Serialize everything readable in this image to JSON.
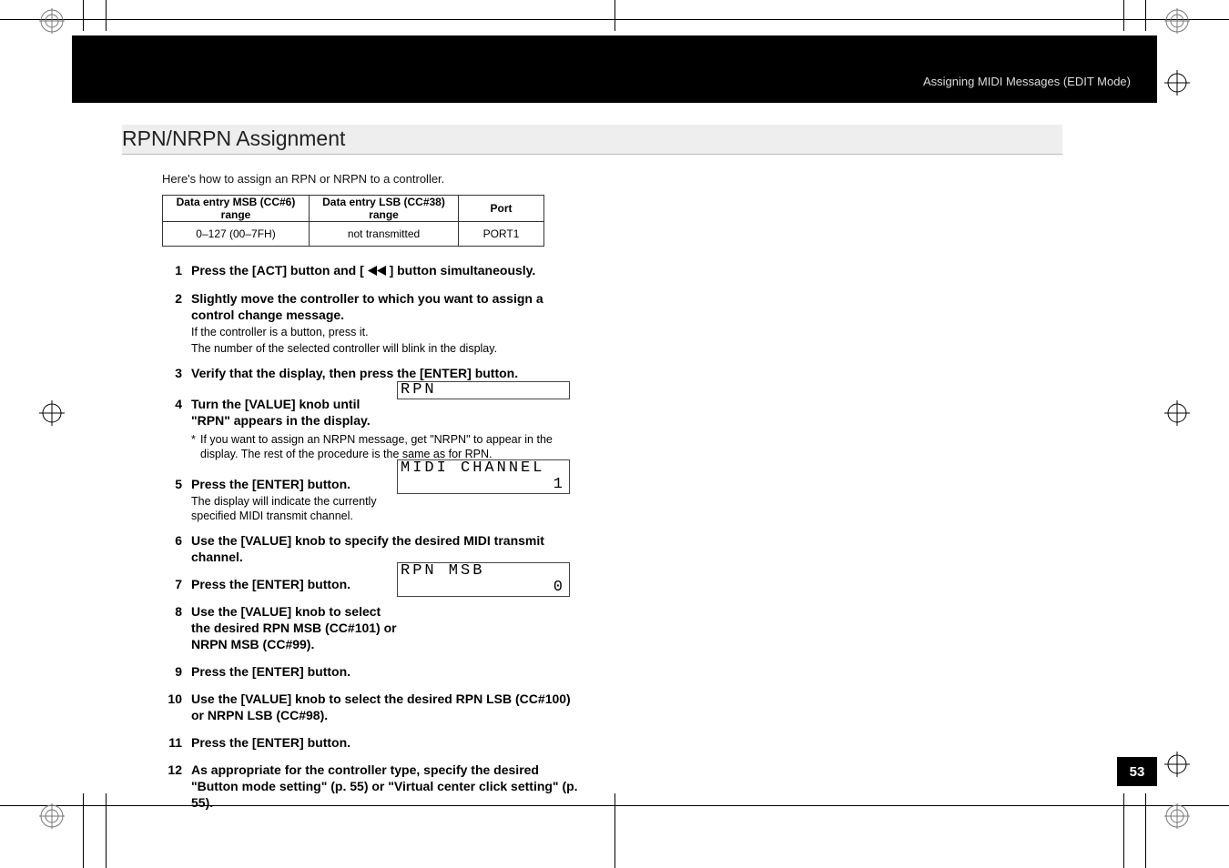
{
  "header": {
    "breadcrumb": "Assigning MIDI Messages (EDIT Mode)"
  },
  "section": {
    "title": "RPN/NRPN Assignment"
  },
  "intro": "Here's how to assign an RPN or NRPN to a controller.",
  "table": {
    "headers": [
      "Data entry MSB (CC#6) range",
      "Data entry LSB (CC#38) range",
      "Port"
    ],
    "row": [
      "0–127 (00–7FH)",
      "not transmitted",
      "PORT1"
    ]
  },
  "steps": {
    "s1": {
      "n": "1",
      "lead_a": "Press the [ACT] button and [ ",
      "lead_b": " ] button simultaneously."
    },
    "s2": {
      "n": "2",
      "lead": "Slightly move the controller to which you want to assign a control change message.",
      "note1": "If the controller is a button, press it.",
      "note2": "The number of the selected controller will blink in the display."
    },
    "s3": {
      "n": "3",
      "lead": "Verify that the display, then press the [ENTER] button."
    },
    "s4": {
      "n": "4",
      "lead": "Turn the [VALUE] knob until \"RPN\" appears in the display.",
      "ast": "If you want to assign an NRPN message, get \"NRPN\" to appear in the display. The rest of the procedure is the same as for RPN."
    },
    "s5": {
      "n": "5",
      "lead": "Press the [ENTER] button.",
      "note": "The display will indicate the currently specified MIDI transmit channel."
    },
    "s6": {
      "n": "6",
      "lead": "Use the [VALUE] knob to specify the desired MIDI transmit channel."
    },
    "s7": {
      "n": "7",
      "lead": "Press the [ENTER] button."
    },
    "s8": {
      "n": "8",
      "lead": "Use the [VALUE] knob to select the desired RPN MSB (CC#101) or NRPN MSB (CC#99)."
    },
    "s9": {
      "n": "9",
      "lead": "Press the [ENTER] button."
    },
    "s10": {
      "n": "10",
      "lead": "Use the [VALUE] knob to select the desired RPN LSB (CC#100) or NRPN LSB (CC#98)."
    },
    "s11": {
      "n": "11",
      "lead": "Press the [ENTER] button."
    },
    "s12": {
      "n": "12",
      "lead": "As appropriate for the controller type, specify the desired  \"Button mode setting\" (p. 55) or  \"Virtual center click setting\" (p. 55)."
    }
  },
  "lcd": {
    "rpn": {
      "line1": "RPN"
    },
    "midi": {
      "line1": "MIDI CHANNEL",
      "line2": "1"
    },
    "msb": {
      "line1": "RPN MSB",
      "line2": "0"
    }
  },
  "page_number": "53",
  "icons": {
    "rewind": "rewind-icon"
  }
}
